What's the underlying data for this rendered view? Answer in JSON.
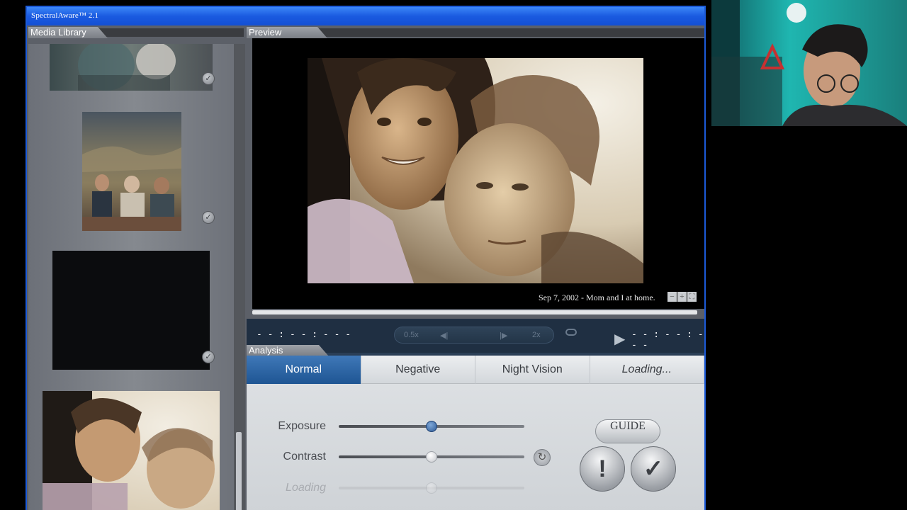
{
  "app": {
    "title": "SpectralAware™ 2.1"
  },
  "library": {
    "header": "Media Library"
  },
  "preview": {
    "header": "Preview",
    "caption": "Sep 7, 2002 - Mom and I at home.",
    "zoom_out": "−",
    "zoom_in": "+",
    "fullscreen": "⛶",
    "progress": 0.02
  },
  "transport": {
    "time_left": "- - : - - : - - -",
    "time_right": "- - : - - : - - -",
    "speed_slow": "0.5x",
    "speed_fast": "2x",
    "prev": "◀|",
    "play": "▶",
    "next": "|▶"
  },
  "analysis": {
    "header": "Analysis",
    "tabs": [
      "Normal",
      "Negative",
      "Night Vision",
      "Loading..."
    ],
    "active_tab": "Normal",
    "sliders": [
      {
        "label": "Exposure",
        "value": 0.5
      },
      {
        "label": "Contrast",
        "value": 0.5
      },
      {
        "label": "Loading",
        "value": 0.5
      }
    ],
    "guide_label": "GUIDE",
    "alert_label": "!",
    "confirm_label": "✓",
    "reset_icon": "↻"
  },
  "colors": {
    "titlebar": "#1a5ae0",
    "active_tab": "#2a63a5",
    "exposure_knob": "#2d5a96"
  }
}
